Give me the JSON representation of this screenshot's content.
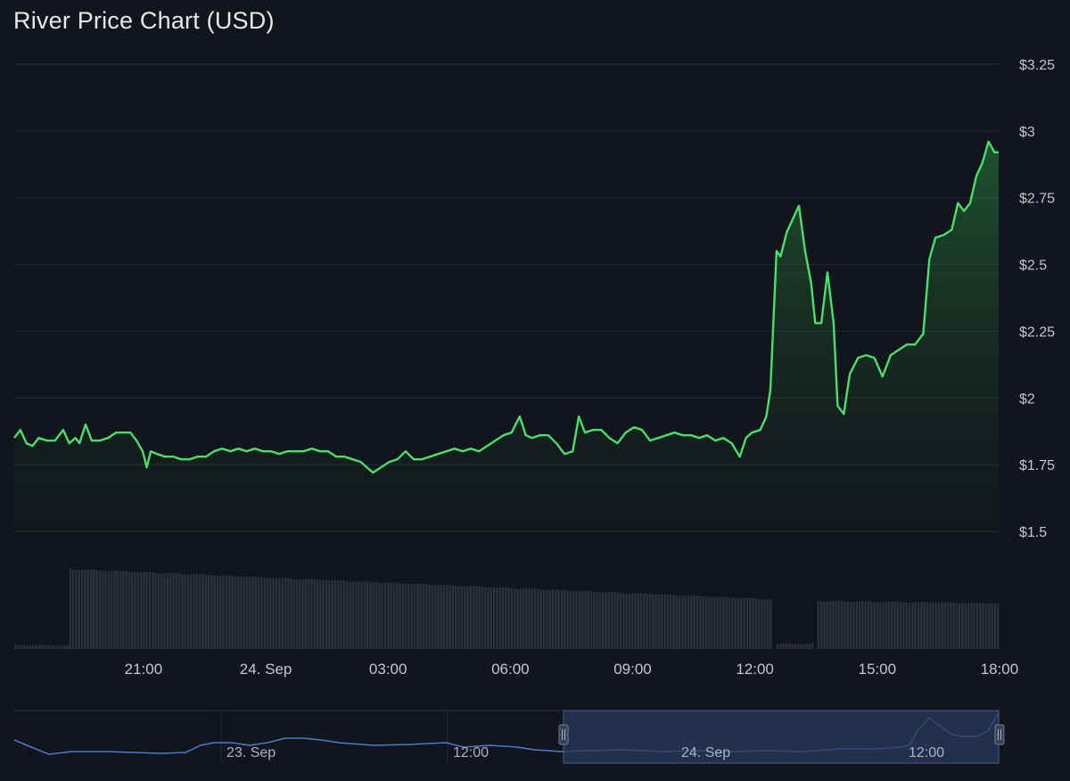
{
  "title": "River Price Chart (USD)",
  "colors": {
    "background": "#12161c",
    "grid": "#262b33",
    "price_line": "#4ade6c",
    "volume_bar": "#2a313c",
    "navigator_line": "#4d79c9",
    "navigator_selection": "#2a3a5c"
  },
  "chart_data": {
    "type": "line",
    "title": "River Price Chart (USD)",
    "y_axis": {
      "range": [
        1.5,
        3.25
      ],
      "tick_labels": [
        "$3.25",
        "$3",
        "$2.75",
        "$2.5",
        "$2.25",
        "$2",
        "$1.75",
        "$1.5"
      ],
      "tick_values": [
        3.25,
        3.0,
        2.75,
        2.5,
        2.25,
        2.0,
        1.75,
        1.5
      ]
    },
    "x_axis": {
      "range": [
        "23 Sep 17:50",
        "24 Sep 18:00"
      ],
      "tick_labels": [
        "21:00",
        "24. Sep",
        "03:00",
        "06:00",
        "09:00",
        "12:00",
        "15:00",
        "18:00"
      ],
      "tick_hours": [
        3.17,
        6.17,
        9.17,
        12.17,
        15.17,
        18.17,
        21.17,
        24.17
      ]
    },
    "grid": true,
    "series": [
      {
        "values_hour_offset_from_start": [
          [
            0.0,
            1.85
          ],
          [
            0.15,
            1.88
          ],
          [
            0.3,
            1.83
          ],
          [
            0.45,
            1.82
          ],
          [
            0.6,
            1.85
          ],
          [
            0.8,
            1.84
          ],
          [
            1.0,
            1.84
          ],
          [
            1.2,
            1.88
          ],
          [
            1.35,
            1.83
          ],
          [
            1.5,
            1.85
          ],
          [
            1.6,
            1.83
          ],
          [
            1.75,
            1.9
          ],
          [
            1.9,
            1.84
          ],
          [
            2.1,
            1.84
          ],
          [
            2.3,
            1.85
          ],
          [
            2.5,
            1.87
          ],
          [
            2.65,
            1.87
          ],
          [
            2.85,
            1.87
          ],
          [
            3.0,
            1.84
          ],
          [
            3.15,
            1.8
          ],
          [
            3.25,
            1.74
          ],
          [
            3.35,
            1.8
          ],
          [
            3.5,
            1.79
          ],
          [
            3.7,
            1.78
          ],
          [
            3.9,
            1.78
          ],
          [
            4.1,
            1.77
          ],
          [
            4.3,
            1.77
          ],
          [
            4.5,
            1.78
          ],
          [
            4.7,
            1.78
          ],
          [
            4.9,
            1.8
          ],
          [
            5.1,
            1.81
          ],
          [
            5.3,
            1.8
          ],
          [
            5.5,
            1.81
          ],
          [
            5.7,
            1.8
          ],
          [
            5.9,
            1.81
          ],
          [
            6.1,
            1.8
          ],
          [
            6.3,
            1.8
          ],
          [
            6.5,
            1.79
          ],
          [
            6.7,
            1.8
          ],
          [
            6.9,
            1.8
          ],
          [
            7.1,
            1.8
          ],
          [
            7.3,
            1.81
          ],
          [
            7.5,
            1.8
          ],
          [
            7.7,
            1.8
          ],
          [
            7.9,
            1.78
          ],
          [
            8.1,
            1.78
          ],
          [
            8.3,
            1.77
          ],
          [
            8.5,
            1.76
          ],
          [
            8.65,
            1.74
          ],
          [
            8.8,
            1.72
          ],
          [
            9.0,
            1.74
          ],
          [
            9.2,
            1.76
          ],
          [
            9.4,
            1.77
          ],
          [
            9.6,
            1.8
          ],
          [
            9.8,
            1.77
          ],
          [
            10.0,
            1.77
          ],
          [
            10.2,
            1.78
          ],
          [
            10.4,
            1.79
          ],
          [
            10.6,
            1.8
          ],
          [
            10.8,
            1.81
          ],
          [
            11.0,
            1.8
          ],
          [
            11.2,
            1.81
          ],
          [
            11.4,
            1.8
          ],
          [
            11.6,
            1.82
          ],
          [
            11.8,
            1.84
          ],
          [
            12.0,
            1.86
          ],
          [
            12.2,
            1.87
          ],
          [
            12.4,
            1.93
          ],
          [
            12.55,
            1.86
          ],
          [
            12.7,
            1.85
          ],
          [
            12.9,
            1.86
          ],
          [
            13.1,
            1.86
          ],
          [
            13.3,
            1.83
          ],
          [
            13.5,
            1.79
          ],
          [
            13.7,
            1.8
          ],
          [
            13.85,
            1.93
          ],
          [
            14.0,
            1.87
          ],
          [
            14.2,
            1.88
          ],
          [
            14.4,
            1.88
          ],
          [
            14.6,
            1.85
          ],
          [
            14.8,
            1.83
          ],
          [
            15.0,
            1.87
          ],
          [
            15.2,
            1.89
          ],
          [
            15.4,
            1.88
          ],
          [
            15.6,
            1.84
          ],
          [
            15.8,
            1.85
          ],
          [
            16.0,
            1.86
          ],
          [
            16.2,
            1.87
          ],
          [
            16.4,
            1.86
          ],
          [
            16.6,
            1.86
          ],
          [
            16.8,
            1.85
          ],
          [
            17.0,
            1.86
          ],
          [
            17.2,
            1.84
          ],
          [
            17.4,
            1.85
          ],
          [
            17.6,
            1.83
          ],
          [
            17.8,
            1.78
          ],
          [
            17.95,
            1.85
          ],
          [
            18.1,
            1.87
          ],
          [
            18.3,
            1.88
          ],
          [
            18.45,
            1.93
          ],
          [
            18.55,
            2.03
          ],
          [
            18.7,
            2.55
          ],
          [
            18.8,
            2.53
          ],
          [
            18.95,
            2.62
          ],
          [
            19.1,
            2.67
          ],
          [
            19.25,
            2.72
          ],
          [
            19.4,
            2.55
          ],
          [
            19.55,
            2.43
          ],
          [
            19.65,
            2.28
          ],
          [
            19.8,
            2.28
          ],
          [
            19.95,
            2.47
          ],
          [
            20.1,
            2.28
          ],
          [
            20.2,
            1.97
          ],
          [
            20.35,
            1.94
          ],
          [
            20.5,
            2.09
          ],
          [
            20.7,
            2.15
          ],
          [
            20.9,
            2.16
          ],
          [
            21.1,
            2.15
          ],
          [
            21.3,
            2.08
          ],
          [
            21.5,
            2.16
          ],
          [
            21.7,
            2.18
          ],
          [
            21.9,
            2.2
          ],
          [
            22.1,
            2.2
          ],
          [
            22.3,
            2.24
          ],
          [
            22.45,
            2.52
          ],
          [
            22.6,
            2.6
          ],
          [
            22.8,
            2.61
          ],
          [
            23.0,
            2.63
          ],
          [
            23.15,
            2.73
          ],
          [
            23.3,
            2.7
          ],
          [
            23.45,
            2.73
          ],
          [
            23.6,
            2.83
          ],
          [
            23.75,
            2.88
          ],
          [
            23.9,
            2.96
          ],
          [
            24.05,
            2.92
          ],
          [
            24.15,
            2.92
          ]
        ]
      }
    ],
    "volume": {
      "segments": [
        {
          "from_hour": 0.0,
          "to_hour": 1.3,
          "level": 0.04
        },
        {
          "from_hour": 1.35,
          "to_hour": 18.6,
          "level_start": 0.97,
          "level_end": 0.6
        },
        {
          "from_hour": 18.7,
          "to_hour": 19.6,
          "level": 0.06
        },
        {
          "from_hour": 19.7,
          "to_hour": 24.15,
          "level_start": 0.58,
          "level_end": 0.55
        }
      ]
    },
    "navigator": {
      "tick_labels": [
        "23. Sep",
        "12:00",
        "24. Sep",
        "12:00"
      ],
      "selection": "24 Sep (last ~24 hours)"
    }
  }
}
